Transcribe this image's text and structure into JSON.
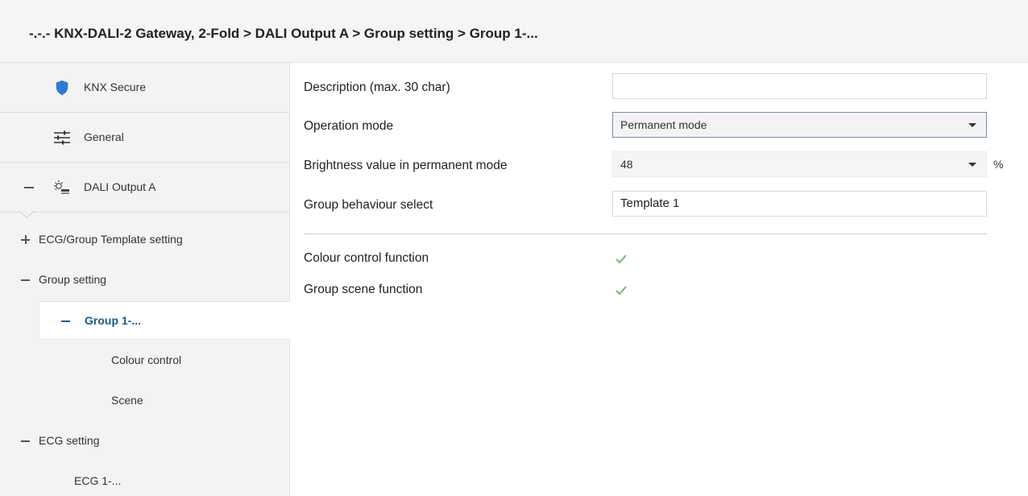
{
  "title": "-.-.- KNX-DALI-2 Gateway, 2-Fold > DALI Output A > Group setting > Group 1-...",
  "sidebar": {
    "top_items": [
      {
        "label": "KNX Secure",
        "icon": "shield-icon"
      },
      {
        "label": "General",
        "icon": "sliders-icon"
      },
      {
        "label": "DALI Output A",
        "icon": "dali-lamp-icon"
      }
    ],
    "tree": [
      {
        "label": "ECG/Group Template setting",
        "sign": "+"
      },
      {
        "label": "Group setting",
        "sign": "−"
      },
      {
        "label": "Group 1-...",
        "sign": "−",
        "selected": true
      },
      {
        "label": "Colour control"
      },
      {
        "label": "Scene"
      },
      {
        "label": "ECG setting",
        "sign": "−"
      },
      {
        "label": "ECG 1-..."
      }
    ]
  },
  "form": {
    "description": {
      "label": "Description (max. 30 char)",
      "value": ""
    },
    "operation_mode": {
      "label": "Operation mode",
      "value": "Permanent mode"
    },
    "brightness": {
      "label": "Brightness value in permanent mode",
      "value": "48",
      "unit": "%"
    },
    "group_behaviour": {
      "label": "Group behaviour select",
      "value": "Template 1"
    },
    "colour_control": {
      "label": "Colour control function",
      "checked": true
    },
    "group_scene": {
      "label": "Group scene function",
      "checked": true
    }
  },
  "colors": {
    "shield": "#2e7bd6",
    "selected_text": "#1c5a8a",
    "check": "#7ab87a"
  }
}
